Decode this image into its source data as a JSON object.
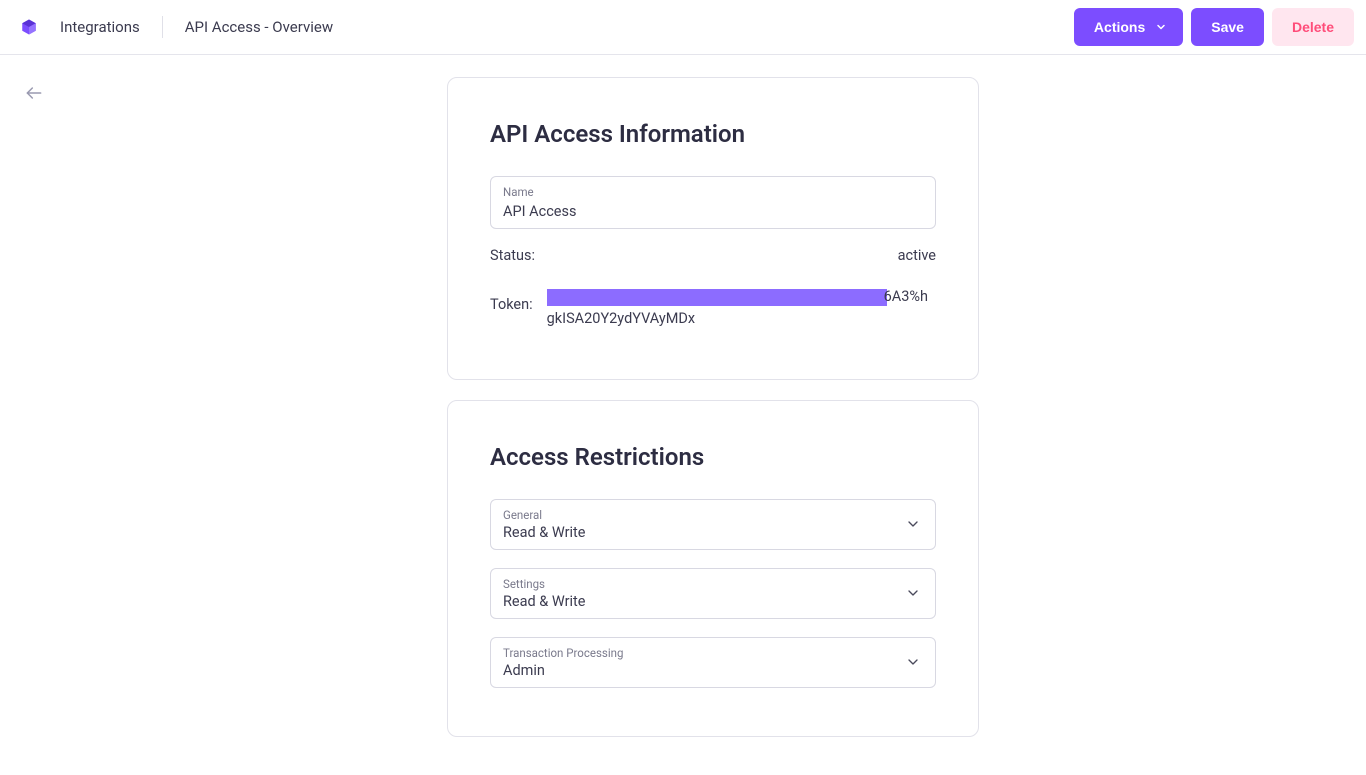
{
  "header": {
    "breadcrumb_integrations": "Integrations",
    "breadcrumb_page": "API Access - Overview",
    "actions_label": "Actions",
    "save_label": "Save",
    "delete_label": "Delete"
  },
  "panel_info": {
    "title": "API Access Information",
    "name_label": "Name",
    "name_value": "API Access",
    "status_label": "Status:",
    "status_value": "active",
    "token_label": "Token:",
    "token_visible_tail": "6A3%hgkISA20Y2ydYVAyMDx"
  },
  "panel_restrictions": {
    "title": "Access Restrictions",
    "fields": [
      {
        "label": "General",
        "value": "Read & Write"
      },
      {
        "label": "Settings",
        "value": "Read & Write"
      },
      {
        "label": "Transaction Processing",
        "value": "Admin"
      }
    ]
  }
}
